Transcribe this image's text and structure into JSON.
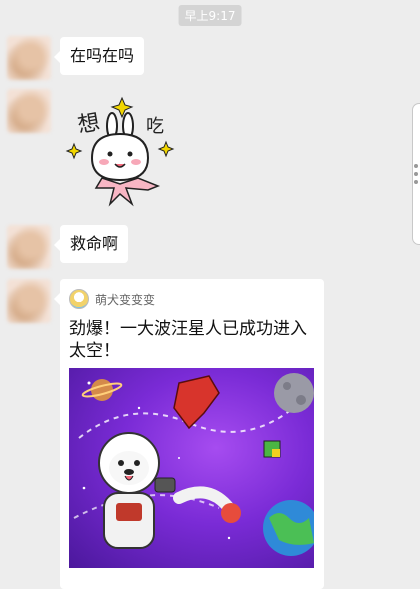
{
  "header": {
    "timestamp": "早上9:17"
  },
  "messages": [
    {
      "type": "text",
      "text": "在吗在吗"
    },
    {
      "type": "sticker",
      "sticker_text_left": "想",
      "sticker_text_right": "吃"
    },
    {
      "type": "text",
      "text": "救命啊"
    },
    {
      "type": "article",
      "source_name": "萌犬变变变",
      "title": "劲爆！一大波汪星人已成功进入太空！"
    }
  ],
  "colors": {
    "chat_background": "#ededed",
    "bubble": "#ffffff",
    "image_purple": "#7a2bd6"
  }
}
